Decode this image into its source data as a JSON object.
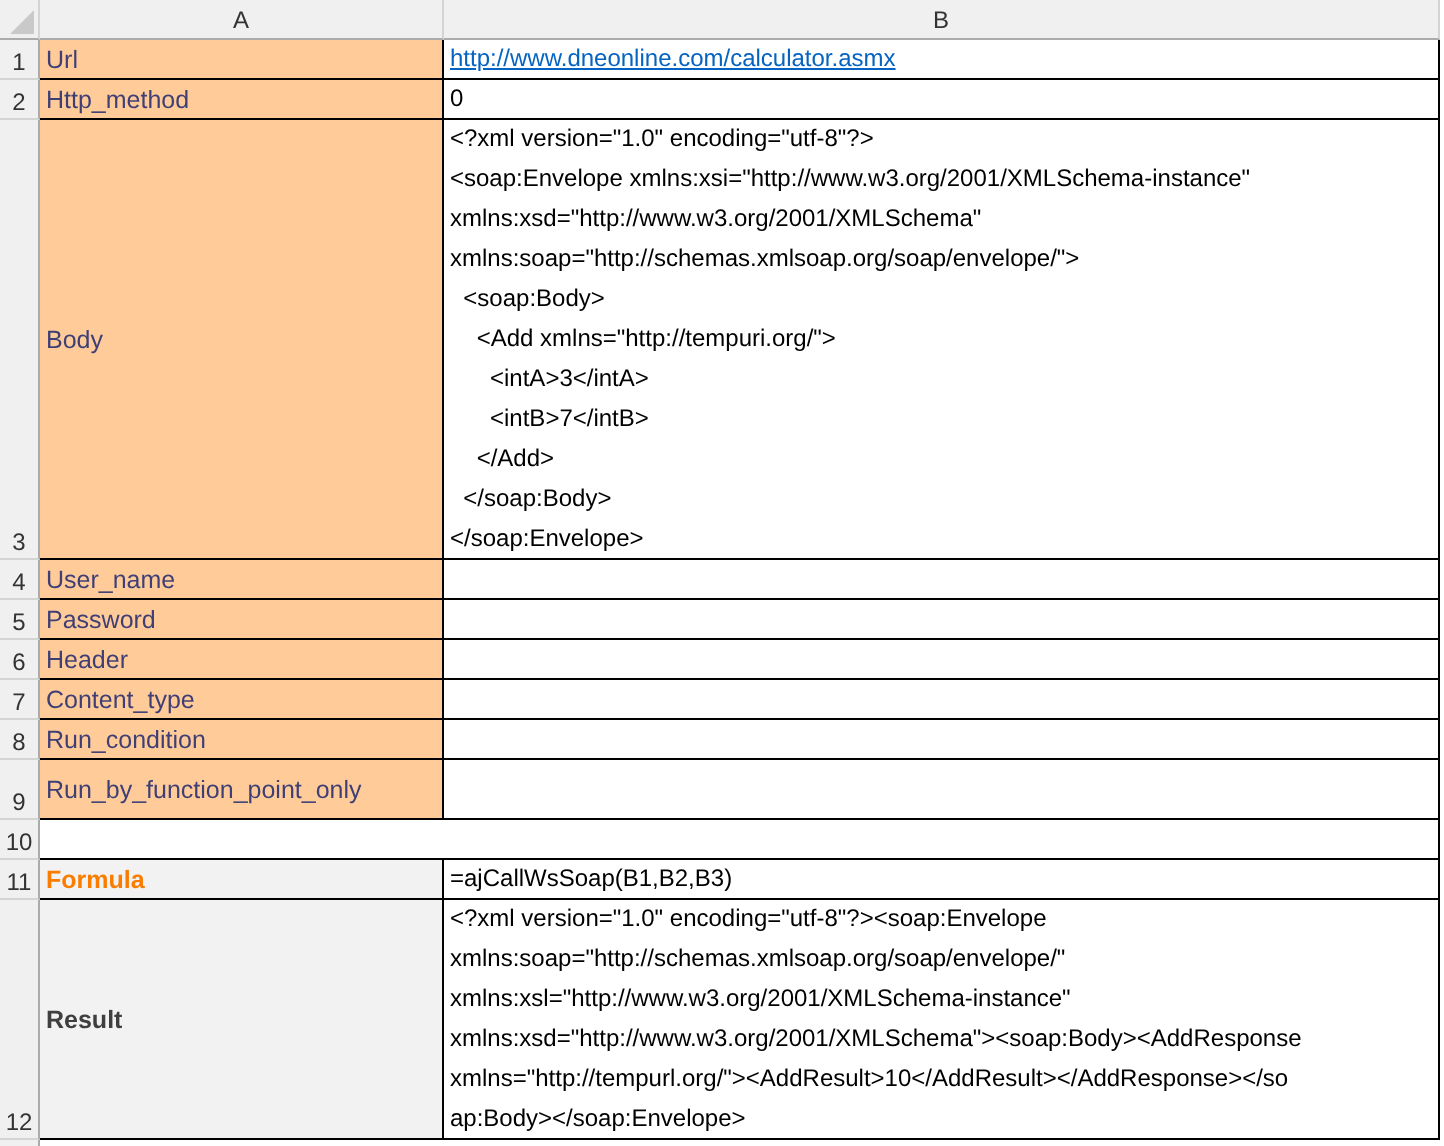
{
  "column_headers": [
    "A",
    "B"
  ],
  "rows": [
    {
      "number": "1",
      "kind": "input",
      "label": "Url",
      "value": "http://www.dneonline.com/calculator.asmx",
      "link": true
    },
    {
      "number": "2",
      "kind": "input",
      "label": "Http_method",
      "value": "0"
    },
    {
      "number": "3",
      "kind": "input",
      "label": "Body",
      "value": "<?xml version=\"1.0\" encoding=\"utf-8\"?>\n<soap:Envelope xmlns:xsi=\"http://www.w3.org/2001/XMLSchema-instance\"\nxmlns:xsd=\"http://www.w3.org/2001/XMLSchema\"\nxmlns:soap=\"http://schemas.xmlsoap.org/soap/envelope/\">\n  <soap:Body>\n    <Add xmlns=\"http://tempuri.org/\">\n      <intA>3</intA>\n      <intB>7</intB>\n    </Add>\n  </soap:Body>\n</soap:Envelope>"
    },
    {
      "number": "4",
      "kind": "input",
      "label": "User_name"
    },
    {
      "number": "5",
      "kind": "input",
      "label": "Password"
    },
    {
      "number": "6",
      "kind": "input",
      "label": "Header"
    },
    {
      "number": "7",
      "kind": "input",
      "label": "Content_type"
    },
    {
      "number": "8",
      "kind": "input",
      "label": "Run_condition"
    },
    {
      "number": "9",
      "kind": "input",
      "label": "Run_by_function_point_only"
    },
    {
      "number": "10",
      "kind": "spacer"
    },
    {
      "number": "11",
      "kind": "formula",
      "label": "Formula",
      "value": "=ajCallWsSoap(B1,B2,B3)"
    },
    {
      "number": "12",
      "kind": "result",
      "label": "Result",
      "value": "<?xml version=\"1.0\" encoding=\"utf-8\"?><soap:Envelope\nxmlns:soap=\"http://schemas.xmlsoap.org/soap/envelope/\"\nxmlns:xsl=\"http://www.w3.org/2001/XMLSchema-instance\"\nxmlns:xsd=\"http://www.w3.org/2001/XMLSchema\"><soap:Body><AddResponse\nxmlns=\"http://tempurl.org/\"><AddResult>10</AddResult></AddResponse></so\nap:Body></soap:Envelope>"
    }
  ]
}
